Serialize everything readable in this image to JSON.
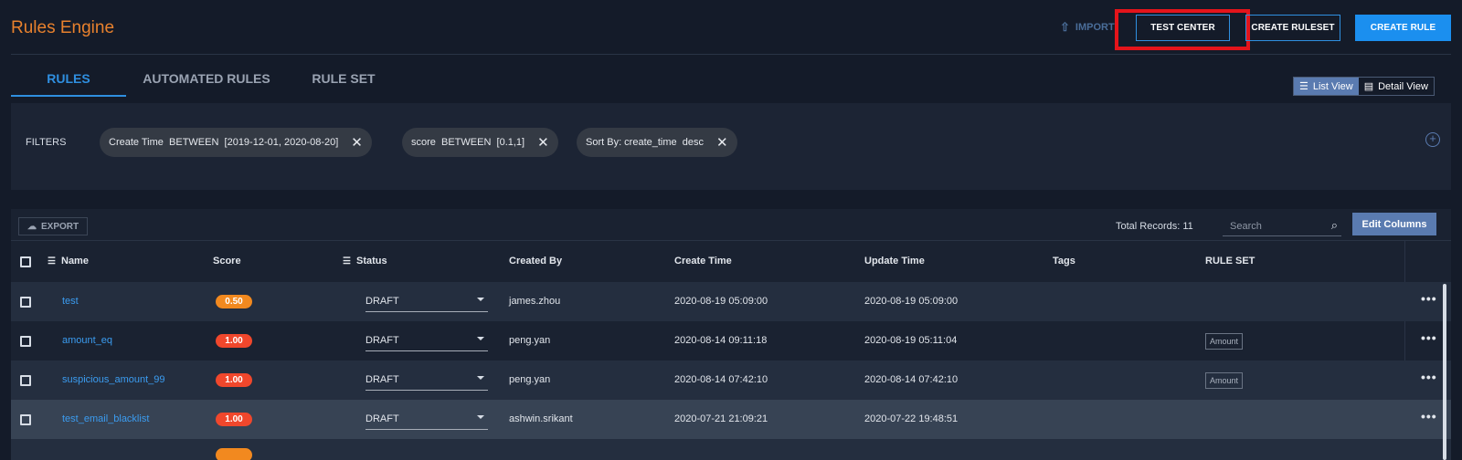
{
  "header": {
    "title": "Rules Engine",
    "import_label": "IMPORT",
    "test_center_label": "TEST CENTER",
    "create_ruleset_label": "CREATE RULESET",
    "create_rule_label": "CREATE RULE"
  },
  "tabs": [
    {
      "label": "RULES",
      "active": true
    },
    {
      "label": "AUTOMATED RULES",
      "active": false
    },
    {
      "label": "RULE SET",
      "active": false
    }
  ],
  "view_toggle": {
    "list_label": "List View",
    "detail_label": "Detail View",
    "selected": "List View"
  },
  "filters": {
    "label": "FILTERS",
    "chips": [
      {
        "text": "Create Time  BETWEEN  [2019-12-01, 2020-08-20]"
      },
      {
        "text": "score  BETWEEN  [0.1,1]"
      },
      {
        "text": "Sort By: create_time  desc"
      }
    ]
  },
  "toolbar": {
    "export_label": "EXPORT",
    "total_records": "Total Records: 11",
    "search_placeholder": "Search",
    "edit_columns_label": "Edit Columns"
  },
  "table": {
    "columns": [
      "Name",
      "Score",
      "Status",
      "Created By",
      "Create Time",
      "Update Time",
      "Tags",
      "RULE SET"
    ],
    "rows": [
      {
        "name": "test",
        "score": "0.50",
        "status": "DRAFT",
        "created_by": "james.zhou",
        "create_time": "2020-08-19 05:09:00",
        "update_time": "2020-08-19 05:09:00",
        "ruleset": ""
      },
      {
        "name": "amount_eq",
        "score": "1.00",
        "status": "DRAFT",
        "created_by": "peng.yan",
        "create_time": "2020-08-14 09:11:18",
        "update_time": "2020-08-19 05:11:04",
        "ruleset": "Amount"
      },
      {
        "name": "suspicious_amount_99",
        "score": "1.00",
        "status": "DRAFT",
        "created_by": "peng.yan",
        "create_time": "2020-08-14 07:42:10",
        "update_time": "2020-08-14 07:42:10",
        "ruleset": "Amount"
      },
      {
        "name": "test_email_blacklist",
        "score": "1.00",
        "status": "DRAFT",
        "created_by": "ashwin.srikant",
        "create_time": "2020-07-21 21:09:21",
        "update_time": "2020-07-22 19:48:51",
        "ruleset": ""
      }
    ]
  },
  "colors": {
    "title": "#e8812d",
    "accent": "#2f8fe0",
    "score_medium": "#f2891f",
    "score_high": "#f0472c",
    "highlight_box": "#e4141b"
  }
}
